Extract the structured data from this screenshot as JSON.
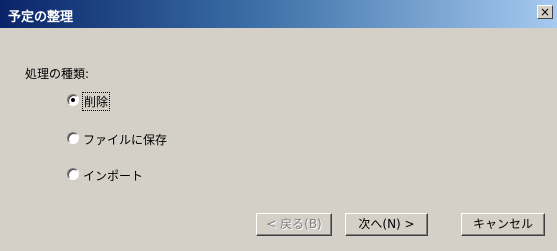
{
  "window": {
    "title": "予定の整理",
    "close_glyph": "×"
  },
  "section_label": "処理の種類:",
  "options": [
    {
      "label": "削除",
      "selected": true
    },
    {
      "label": "ファイルに保存",
      "selected": false
    },
    {
      "label": "インポート",
      "selected": false
    }
  ],
  "buttons": {
    "back": "< 戻る(B)",
    "next": "次へ(N) >",
    "cancel": "キャンセル"
  },
  "colors": {
    "titlebar_start": "#0a246a",
    "titlebar_end": "#a6caf0",
    "face": "#d4d0c8"
  }
}
